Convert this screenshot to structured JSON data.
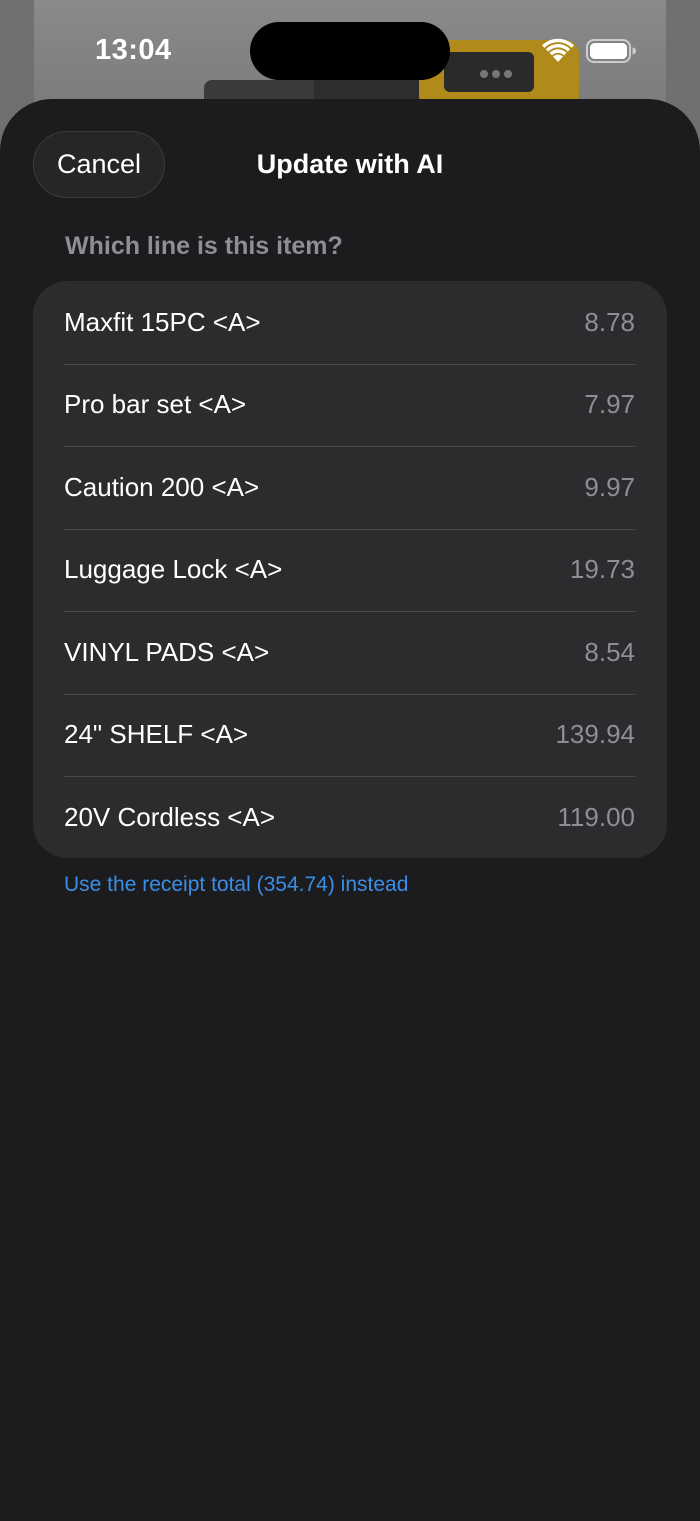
{
  "status_bar": {
    "time": "13:04",
    "wifi_icon": "wifi-icon",
    "battery_icon": "battery-icon"
  },
  "sheet": {
    "cancel_label": "Cancel",
    "title": "Update with AI",
    "section_header": "Which line is this item?",
    "items": [
      {
        "name": "Maxfit 15PC <A>",
        "price": "8.78"
      },
      {
        "name": "Pro bar set <A>",
        "price": "7.97"
      },
      {
        "name": "Caution 200 <A>",
        "price": "9.97"
      },
      {
        "name": "Luggage Lock <A>",
        "price": "19.73"
      },
      {
        "name": "VINYL PADS <A>",
        "price": "8.54"
      },
      {
        "name": "24\" SHELF <A>",
        "price": "139.94"
      },
      {
        "name": "20V Cordless <A>",
        "price": "119.00"
      }
    ],
    "total_link": "Use the receipt total (354.74) instead"
  },
  "colors": {
    "sheet_background": "#1c1c1e",
    "card_background": "#2c2c2e",
    "link": "#3a8ee6",
    "secondary_text": "#8e8e93"
  }
}
